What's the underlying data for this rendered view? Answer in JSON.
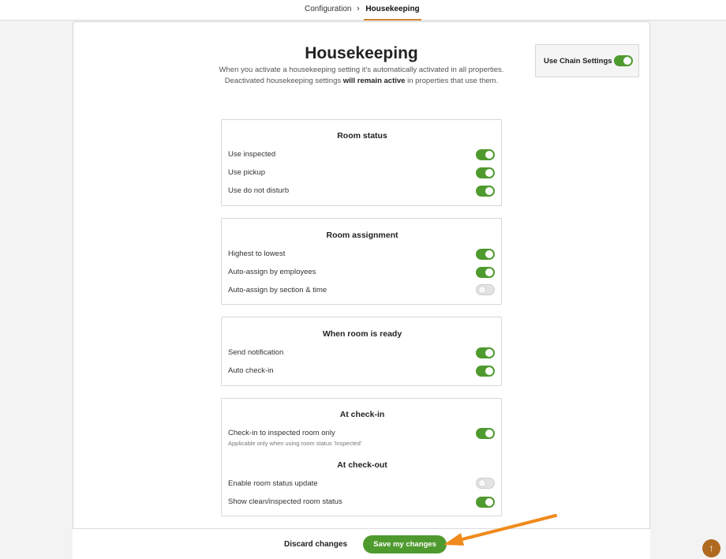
{
  "breadcrumb": {
    "parent": "Configuration",
    "separator": "›",
    "current": "Housekeeping"
  },
  "header": {
    "title": "Housekeeping",
    "description_part1": "When you activate a housekeeping setting it's automatically activated in all properties. Deactivated housekeeping settings ",
    "description_bold": "will remain active",
    "description_part2": " in properties that use them."
  },
  "chain_settings": {
    "label": "Use Chain Settings",
    "enabled": true
  },
  "sections": {
    "room_status": {
      "title": "Room status",
      "rows": [
        {
          "label": "Use inspected",
          "enabled": true
        },
        {
          "label": "Use pickup",
          "enabled": true
        },
        {
          "label": "Use do not disturb",
          "enabled": true
        }
      ]
    },
    "room_assignment": {
      "title": "Room assignment",
      "rows": [
        {
          "label": "Highest to lowest",
          "enabled": true
        },
        {
          "label": "Auto-assign by employees",
          "enabled": true
        },
        {
          "label": "Auto-assign by section & time",
          "enabled": false
        }
      ]
    },
    "room_ready": {
      "title": "When room is ready",
      "rows": [
        {
          "label": "Send notification",
          "enabled": true
        },
        {
          "label": "Auto check-in",
          "enabled": true
        }
      ]
    },
    "check_in": {
      "title": "At check-in",
      "rows": [
        {
          "label": "Check-in to inspected room only",
          "sublabel": "Applicable only when using room status 'Inspected'",
          "enabled": true
        }
      ]
    },
    "check_out": {
      "title": "At check-out",
      "rows": [
        {
          "label": "Enable room status update",
          "enabled": false
        },
        {
          "label": "Show clean/inspected room status",
          "enabled": true
        }
      ]
    }
  },
  "footer": {
    "discard_label": "Discard changes",
    "save_label": "Save my changes"
  },
  "scroll_top": {
    "icon": "arrow-up-icon",
    "glyph": "↑"
  },
  "colors": {
    "toggle_on": "#4f9a2e",
    "accent_orange": "#f08a1c",
    "scroll_button": "#b06a1f"
  }
}
